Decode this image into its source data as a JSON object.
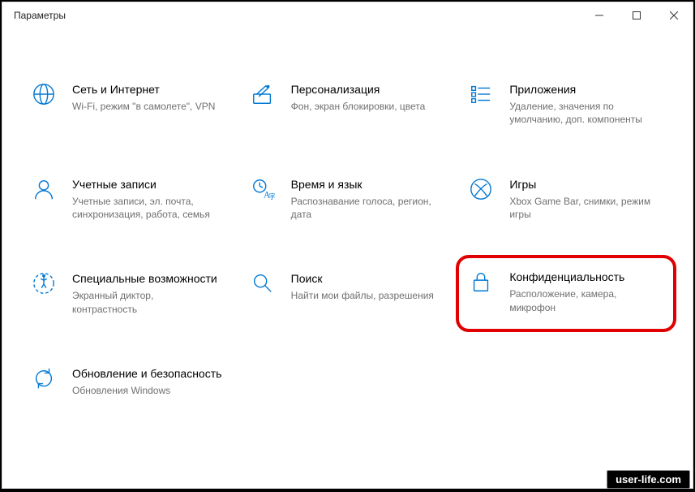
{
  "window": {
    "title": "Параметры"
  },
  "tiles": {
    "network": {
      "title": "Сеть и Интернет",
      "desc": "Wi-Fi, режим \"в самолете\", VPN"
    },
    "personalization": {
      "title": "Персонализация",
      "desc": "Фон, экран блокировки, цвета"
    },
    "apps": {
      "title": "Приложения",
      "desc": "Удаление, значения по умолчанию, доп. компоненты"
    },
    "accounts": {
      "title": "Учетные записи",
      "desc": "Учетные записи, эл. почта, синхронизация, работа, семья"
    },
    "time": {
      "title": "Время и язык",
      "desc": "Распознавание голоса, регион, дата"
    },
    "gaming": {
      "title": "Игры",
      "desc": "Xbox Game Bar, снимки, режим игры"
    },
    "ease": {
      "title": "Специальные возможности",
      "desc": "Экранный диктор, контрастность"
    },
    "search": {
      "title": "Поиск",
      "desc": "Найти мои файлы, разрешения"
    },
    "privacy": {
      "title": "Конфиденциальность",
      "desc": "Расположение, камера, микрофон"
    },
    "update": {
      "title": "Обновление и безопасность",
      "desc": "Обновления Windows"
    }
  },
  "watermark": "user-life.com"
}
